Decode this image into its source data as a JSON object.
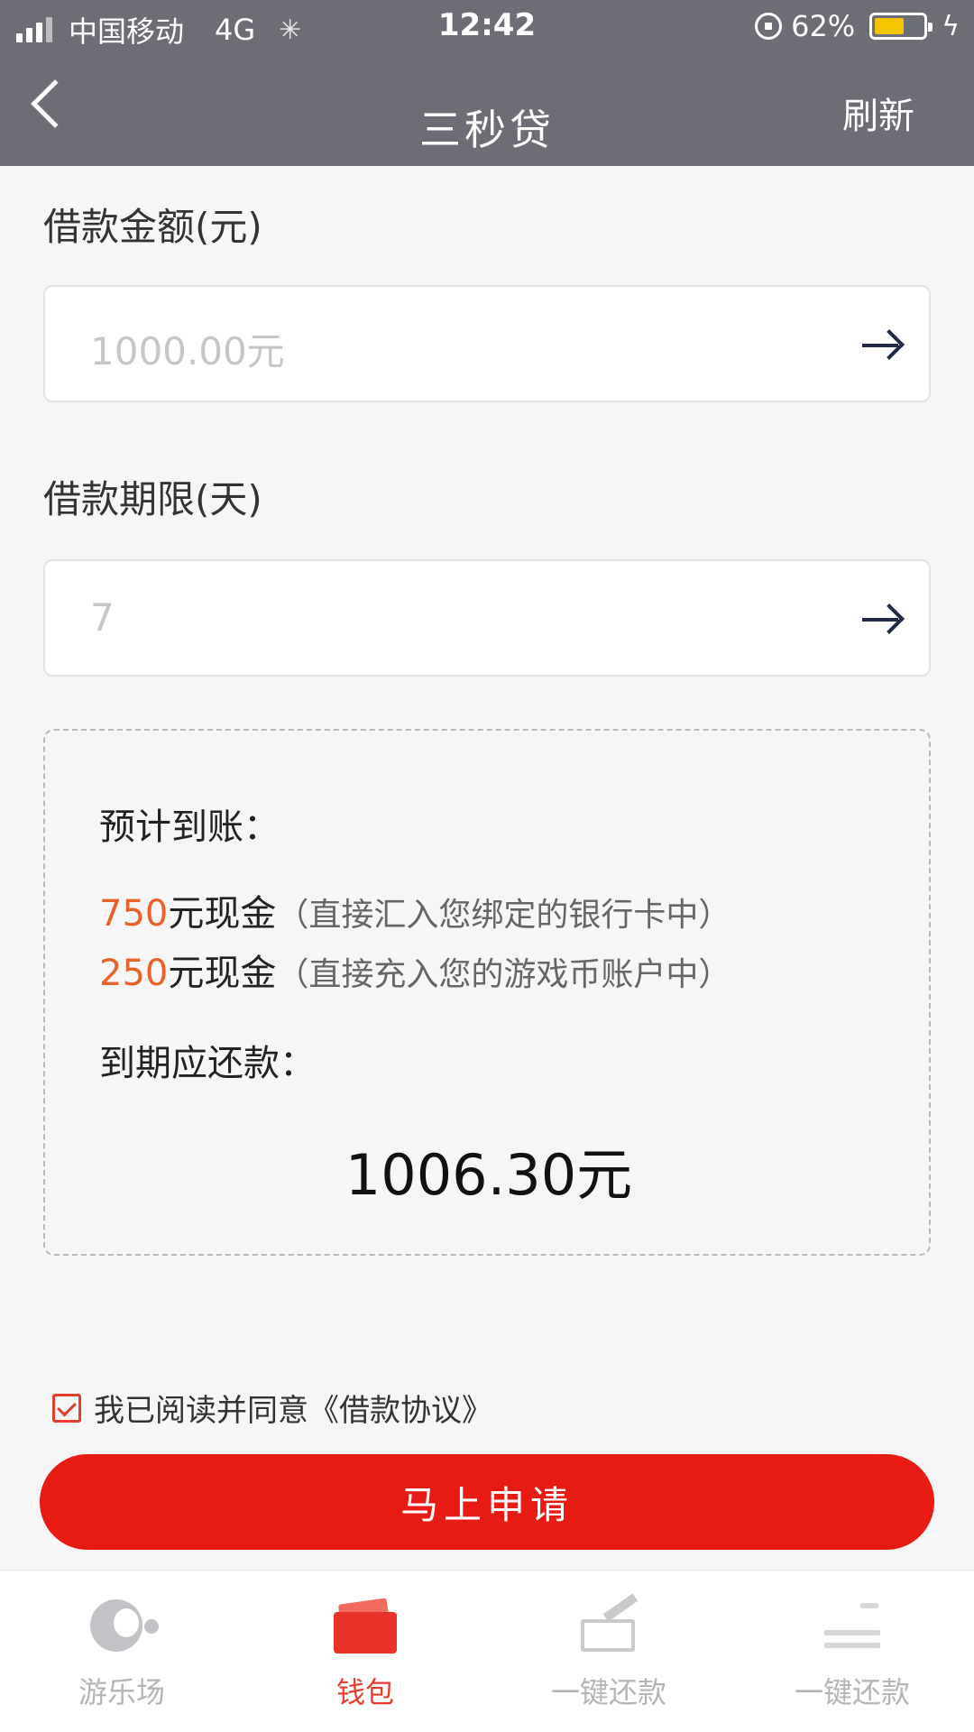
{
  "status_bar": {
    "carrier": "中国移动",
    "network": "4G",
    "time": "12:42",
    "battery_percent": "62%",
    "battery_level": 0.62,
    "icons": [
      "signal-icon",
      "loading-icon",
      "orientation-lock-icon",
      "battery-icon",
      "charging-icon"
    ]
  },
  "nav": {
    "title": "三秒贷",
    "refresh_label": "刷新"
  },
  "loan_amount": {
    "label": "借款金额(元)",
    "value": "1000.00元"
  },
  "loan_term": {
    "label": "借款期限(天)",
    "value": "7"
  },
  "summary": {
    "expected_label": "预计到账：",
    "lines": [
      {
        "amount": "750",
        "unit": "元现金",
        "note": "（直接汇入您绑定的银行卡中）"
      },
      {
        "amount": "250",
        "unit": "元现金",
        "note": "（直接充入您的游戏币账户中）"
      }
    ],
    "due_label": "到期应还款：",
    "due_amount": "1006.30元"
  },
  "agreement": {
    "checked": true,
    "text": "我已阅读并同意《借款协议》"
  },
  "apply_button": {
    "label": "马上申请"
  },
  "tabs": [
    {
      "label": "游乐场",
      "icon": "moon-icon",
      "active": false
    },
    {
      "label": "钱包",
      "icon": "wallet-icon",
      "active": true
    },
    {
      "label": "一键还款",
      "icon": "repay-icon",
      "active": false
    },
    {
      "label": "一键还款",
      "icon": "repay-icon",
      "active": false
    }
  ],
  "colors": {
    "header_bg": "#6b6e74",
    "accent_red": "#e81b14",
    "amount_orange": "#e8622a"
  }
}
